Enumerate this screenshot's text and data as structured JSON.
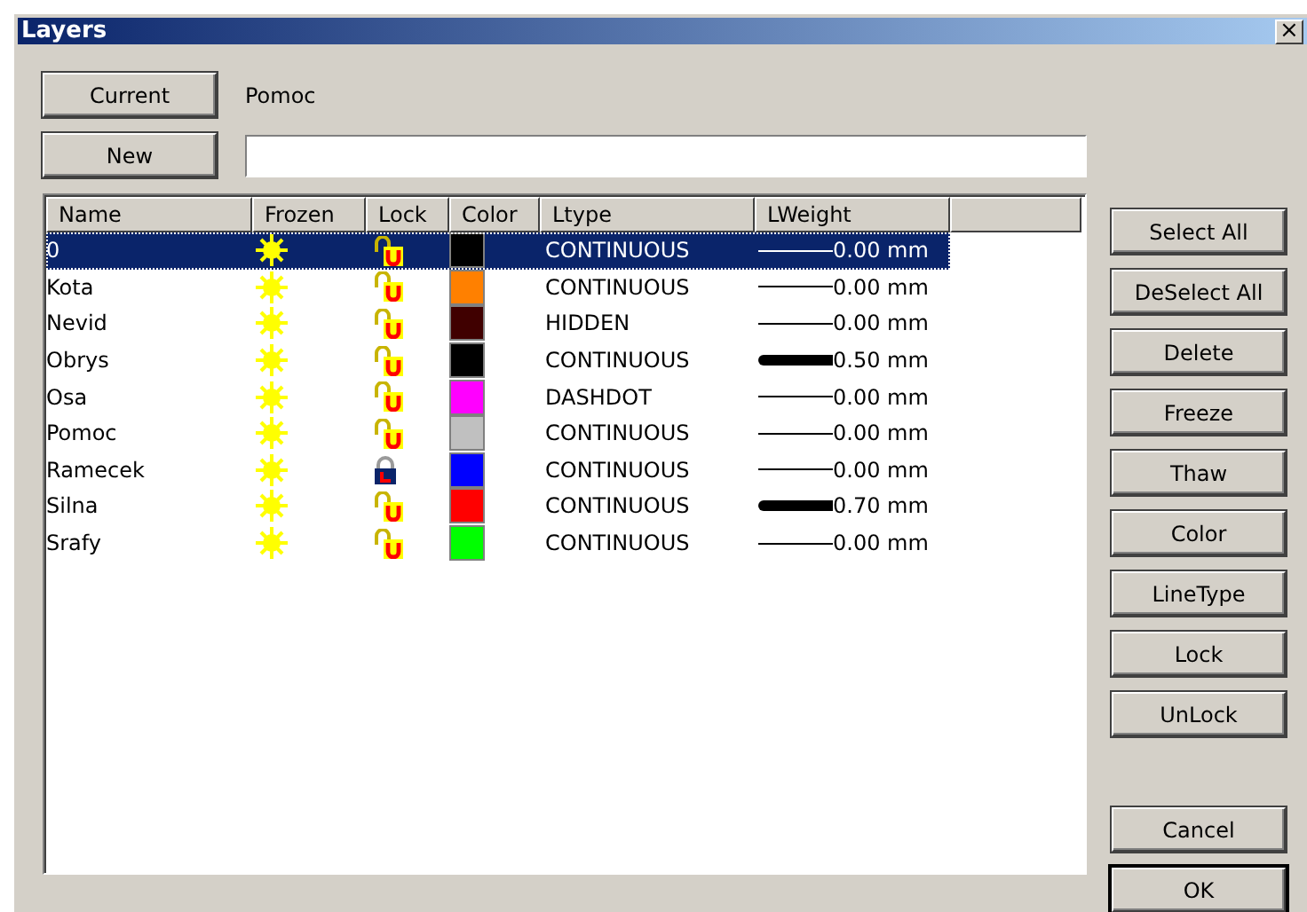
{
  "window": {
    "title": "Layers",
    "close": "×"
  },
  "current": {
    "button": "Current",
    "value": "Pomoc"
  },
  "new": {
    "button": "New"
  },
  "table": {
    "columns": [
      "Name",
      "Frozen",
      "Lock",
      "Color",
      "Ltype",
      "LWeight"
    ],
    "rows": [
      {
        "name": "0",
        "selected": true,
        "frozen": false,
        "locked": false,
        "color": "#000000",
        "ltype": "CONTINUOUS",
        "kind": "thin",
        "lweight": "0.00 mm"
      },
      {
        "name": "Kota",
        "selected": false,
        "frozen": false,
        "locked": false,
        "color": "#ff8000",
        "ltype": "CONTINUOUS",
        "kind": "thin",
        "lweight": "0.00 mm"
      },
      {
        "name": "Nevid",
        "selected": false,
        "frozen": false,
        "locked": false,
        "color": "#400000",
        "ltype": "HIDDEN",
        "kind": "thin",
        "lweight": "0.00 mm"
      },
      {
        "name": "Obrys",
        "selected": false,
        "frozen": false,
        "locked": false,
        "color": "#000000",
        "ltype": "CONTINUOUS",
        "kind": "thick",
        "lweight": "0.50 mm"
      },
      {
        "name": "Osa",
        "selected": false,
        "frozen": false,
        "locked": false,
        "color": "#ff00ff",
        "ltype": "DASHDOT",
        "kind": "thin",
        "lweight": "0.00 mm"
      },
      {
        "name": "Pomoc",
        "selected": false,
        "frozen": false,
        "locked": false,
        "color": "#c0c0c0",
        "ltype": "CONTINUOUS",
        "kind": "thin",
        "lweight": "0.00 mm"
      },
      {
        "name": "Ramecek",
        "selected": false,
        "frozen": false,
        "locked": true,
        "color": "#0000ff",
        "ltype": "CONTINUOUS",
        "kind": "thin",
        "lweight": "0.00 mm"
      },
      {
        "name": "Silna",
        "selected": false,
        "frozen": false,
        "locked": false,
        "color": "#ff0000",
        "ltype": "CONTINUOUS",
        "kind": "thick",
        "lweight": "0.70 mm"
      },
      {
        "name": "Srafy",
        "selected": false,
        "frozen": false,
        "locked": false,
        "color": "#00ff00",
        "ltype": "CONTINUOUS",
        "kind": "thin",
        "lweight": "0.00 mm"
      }
    ]
  },
  "side_buttons": [
    {
      "label": "Select All",
      "default": false
    },
    {
      "label": "DeSelect All",
      "default": false
    },
    {
      "label": "Delete",
      "default": false
    },
    {
      "label": "Freeze",
      "default": false
    },
    {
      "label": "Thaw",
      "default": false
    },
    {
      "label": "Color",
      "default": false
    },
    {
      "label": "LineType",
      "default": false
    },
    {
      "label": "Lock",
      "default": false
    },
    {
      "label": "UnLock",
      "default": false
    }
  ],
  "bottom_buttons": [
    {
      "label": "Cancel",
      "default": false
    },
    {
      "label": "OK",
      "default": true
    }
  ]
}
